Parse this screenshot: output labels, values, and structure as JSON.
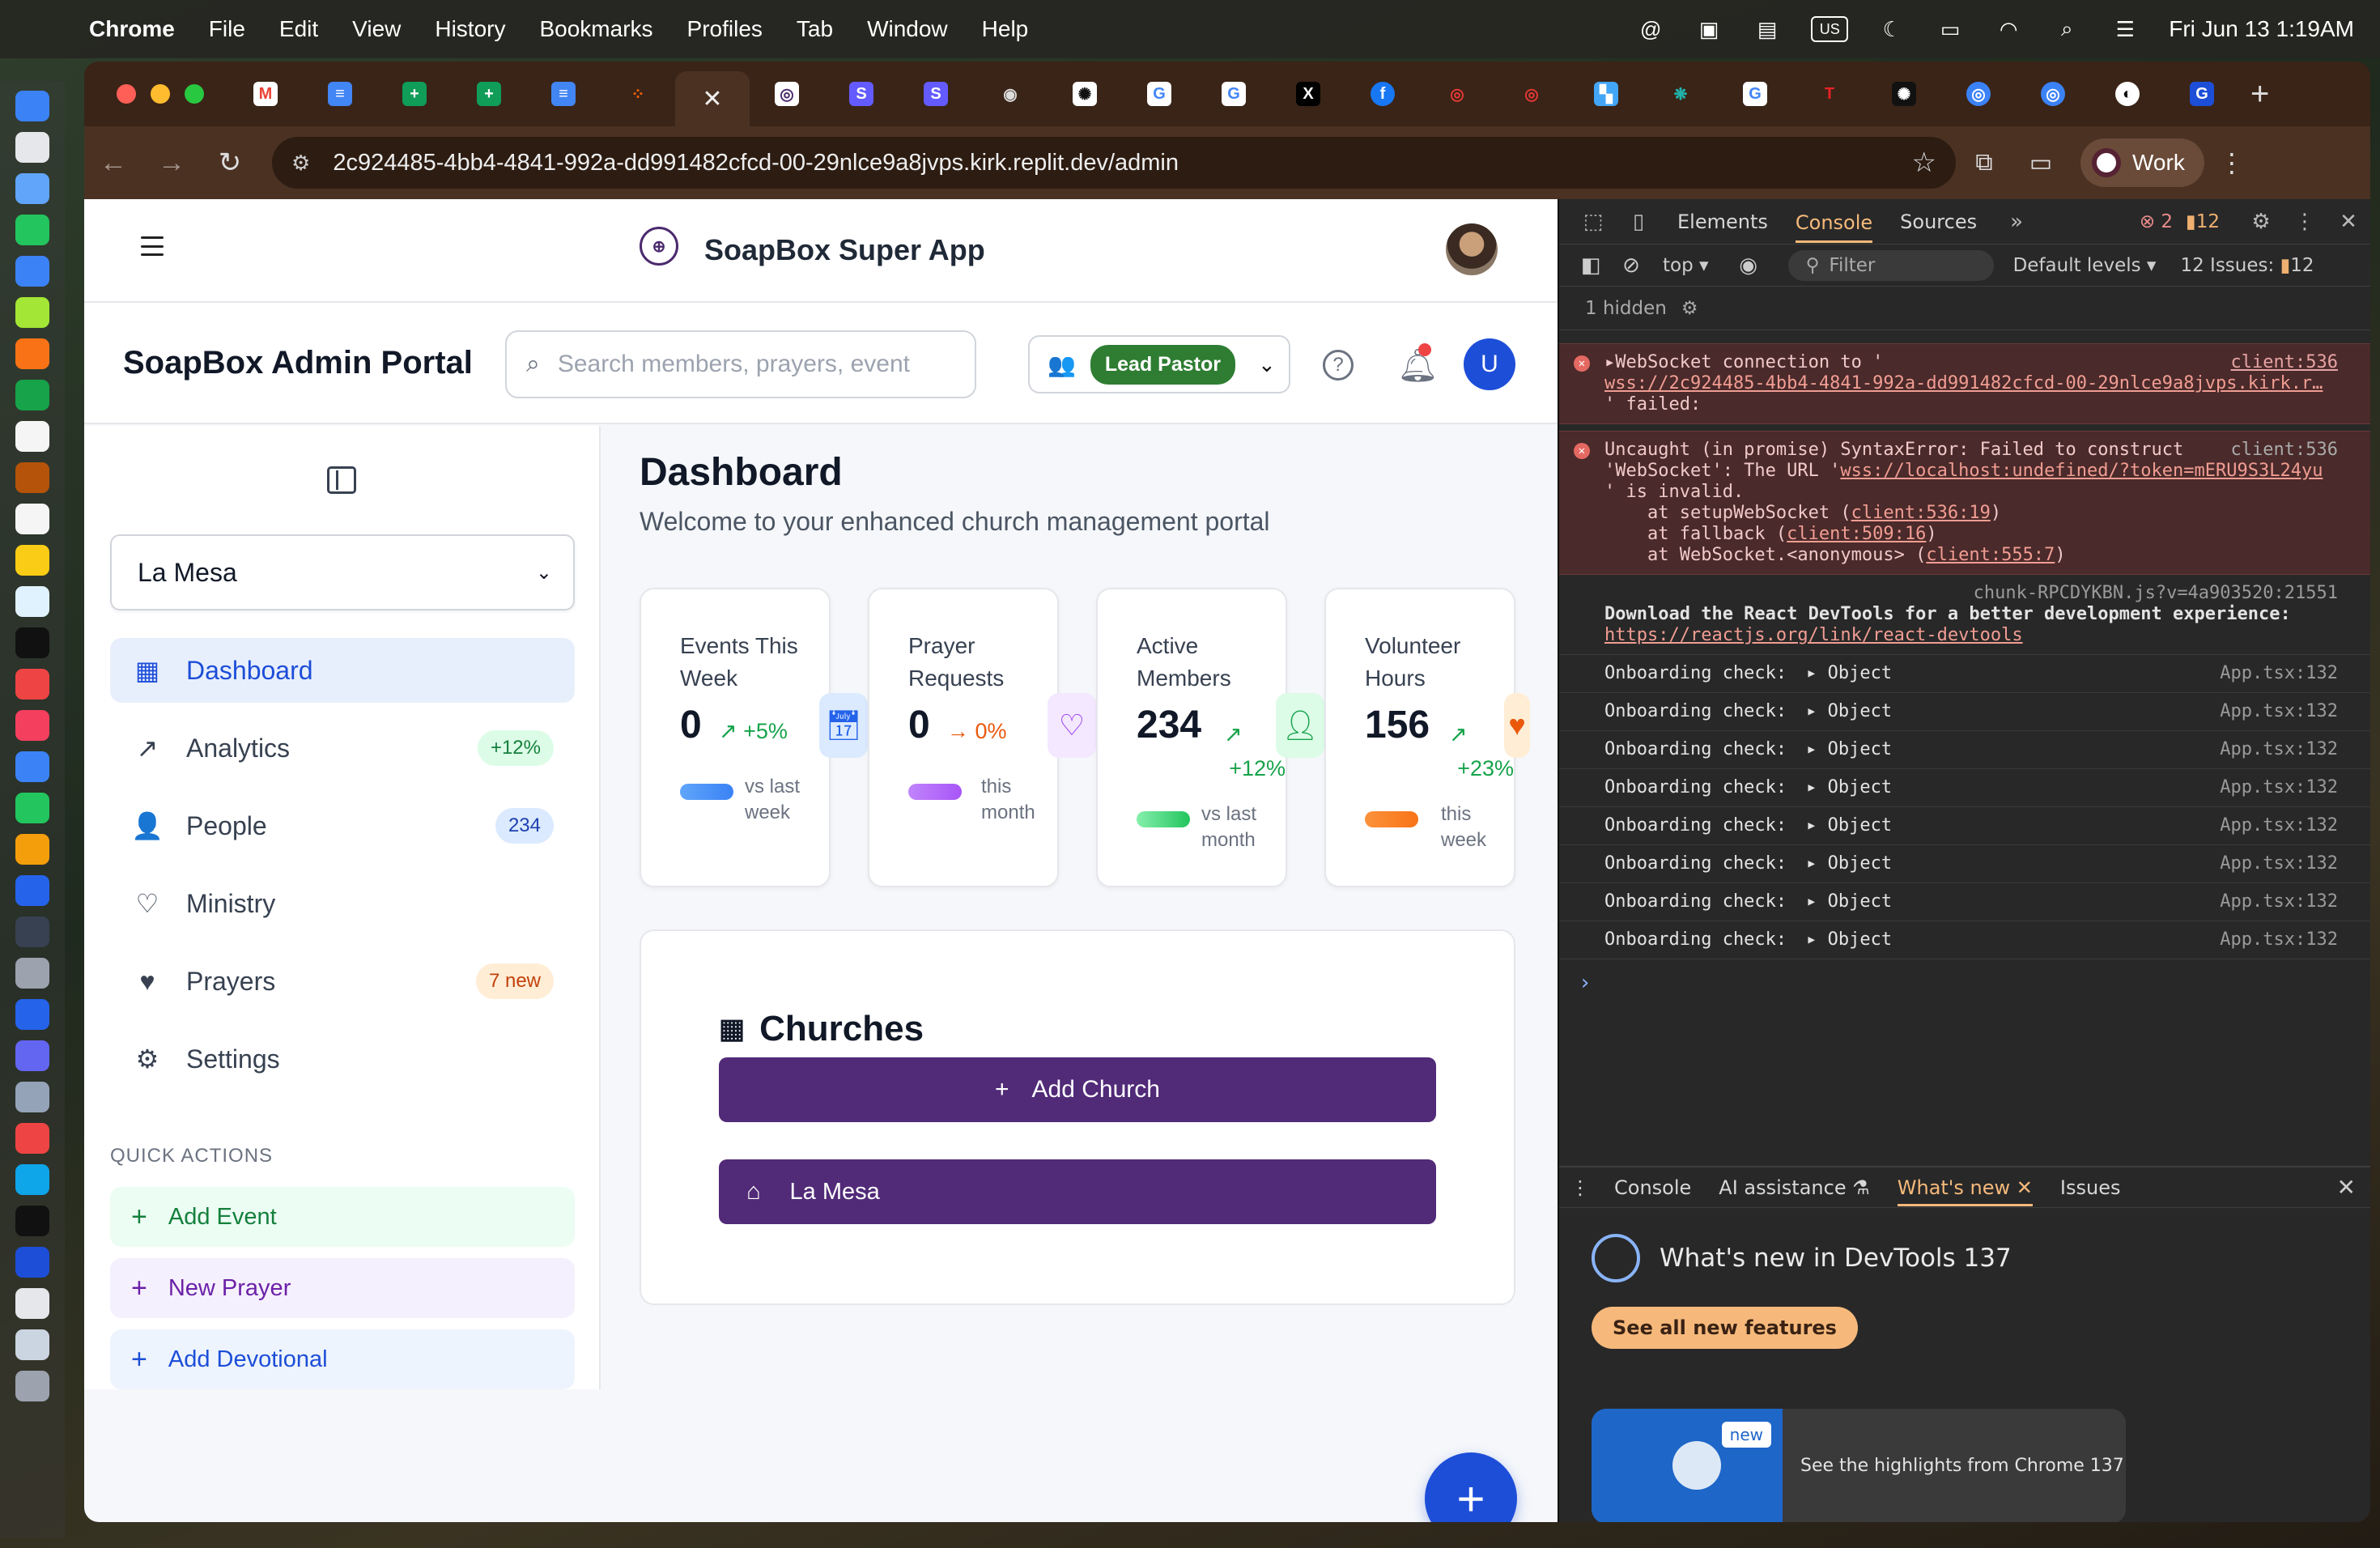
{
  "menubar": {
    "app_name": "Chrome",
    "items": [
      "File",
      "Edit",
      "View",
      "History",
      "Bookmarks",
      "Profiles",
      "Tab",
      "Window",
      "Help"
    ],
    "input_source": "US",
    "clock": "Fri Jun 13  1:19AM"
  },
  "browser": {
    "url": "2c924485-4bb4-4841-992a-dd991482cfcd-00-29nlce9a8jvps.kirk.replit.dev/admin",
    "profile_label": "Work",
    "new_tab": "+"
  },
  "app": {
    "title": "SoapBox Super App",
    "logo_text": "SOAPBOX"
  },
  "portal": {
    "title": "SoapBox Admin Portal",
    "search_placeholder": "Search members, prayers, event",
    "role_badge": "Lead Pastor",
    "user_initial": "U"
  },
  "sidebar": {
    "church_selected": "La Mesa",
    "nav": [
      {
        "label": "Dashboard",
        "active": true,
        "icon": "building-icon"
      },
      {
        "label": "Analytics",
        "badge": "+12%",
        "icon": "trending-up-icon"
      },
      {
        "label": "People",
        "badge": "234",
        "icon": "users-icon"
      },
      {
        "label": "Ministry",
        "icon": "heart-icon"
      },
      {
        "label": "Prayers",
        "badge": "7 new",
        "icon": "hand-heart-icon"
      },
      {
        "label": "Settings",
        "icon": "gear-icon"
      }
    ],
    "quick_actions_label": "QUICK ACTIONS",
    "quick_actions": [
      "Add Event",
      "New Prayer",
      "Add Devotional"
    ]
  },
  "dashboard": {
    "title": "Dashboard",
    "subtitle": "Welcome to your enhanced church management portal",
    "stats": [
      {
        "label": "Events This Week",
        "value": "0",
        "change": "+5%",
        "change_arrow": "↗",
        "foot": "vs last week",
        "color": "#16a34a"
      },
      {
        "label": "Prayer Requests",
        "value": "0",
        "change": "0%",
        "change_arrow": "→",
        "foot": "this month",
        "color": "#ea580c"
      },
      {
        "label": "Active Members",
        "value": "234",
        "change": "+12%",
        "change_arrow": "↗",
        "foot": "vs last month",
        "color": "#16a34a"
      },
      {
        "label": "Volunteer Hours",
        "value": "156",
        "change": "+23%",
        "change_arrow": "↗",
        "foot": "this week",
        "color": "#16a34a"
      }
    ],
    "churches_title": "Churches",
    "add_church": "Add Church",
    "church_rows": [
      "La Mesa"
    ],
    "fab": "+"
  },
  "devtools": {
    "tabs": [
      "Elements",
      "Console",
      "Sources"
    ],
    "active_tab": "Console",
    "error_count": "2",
    "warning_count": "12",
    "context": "top",
    "filter_placeholder": "Filter",
    "levels": "Default levels",
    "issues": "12 Issues:",
    "issues_count": "12",
    "hidden": "1 hidden",
    "messages": {
      "err1_line1": "WebSocket connection to '",
      "err1_url": "wss://2c924485-4bb4-4841-992a-dd991482cfcd-00-29nlce9a8jvps.kirk.r…",
      "err1_line3": "' failed:",
      "err1_src": "client:536",
      "err2_line1": "Uncaught (in promise) SyntaxError: Failed to construct",
      "err2_line2a": "'WebSocket': The URL '",
      "err2_url": "wss://localhost:undefined/?token=mERU9S3L24yu",
      "err2_line3": "' is invalid.",
      "err2_stack1a": "    at setupWebSocket (",
      "err2_stack1b": "client:536:19",
      "err2_stack2a": "    at fallback (",
      "err2_stack2b": "client:509:16",
      "err2_stack3a": "    at WebSocket.<anonymous> (",
      "err2_stack3b": "client:555:7",
      "err2_src": "client:536",
      "react_src": "chunk-RPCDYKBN.js?v=4a903520:21551",
      "react_line1": "Download the React DevTools for a better development experience:",
      "react_link": "https://reactjs.org/link/react-devtools",
      "onboarding_label": "Onboarding check:",
      "onboarding_value": "Object",
      "onboarding_src": "App.tsx:132",
      "onboarding_count": 8
    },
    "drawer_tabs": [
      "Console",
      "AI assistance",
      "What's new",
      "Issues"
    ],
    "drawer_active": "What's new",
    "whats_new_title": "What's new in DevTools 137",
    "see_all": "See all new features",
    "highlight_badge": "new",
    "highlight_text": "See the highlights from Chrome 137"
  }
}
